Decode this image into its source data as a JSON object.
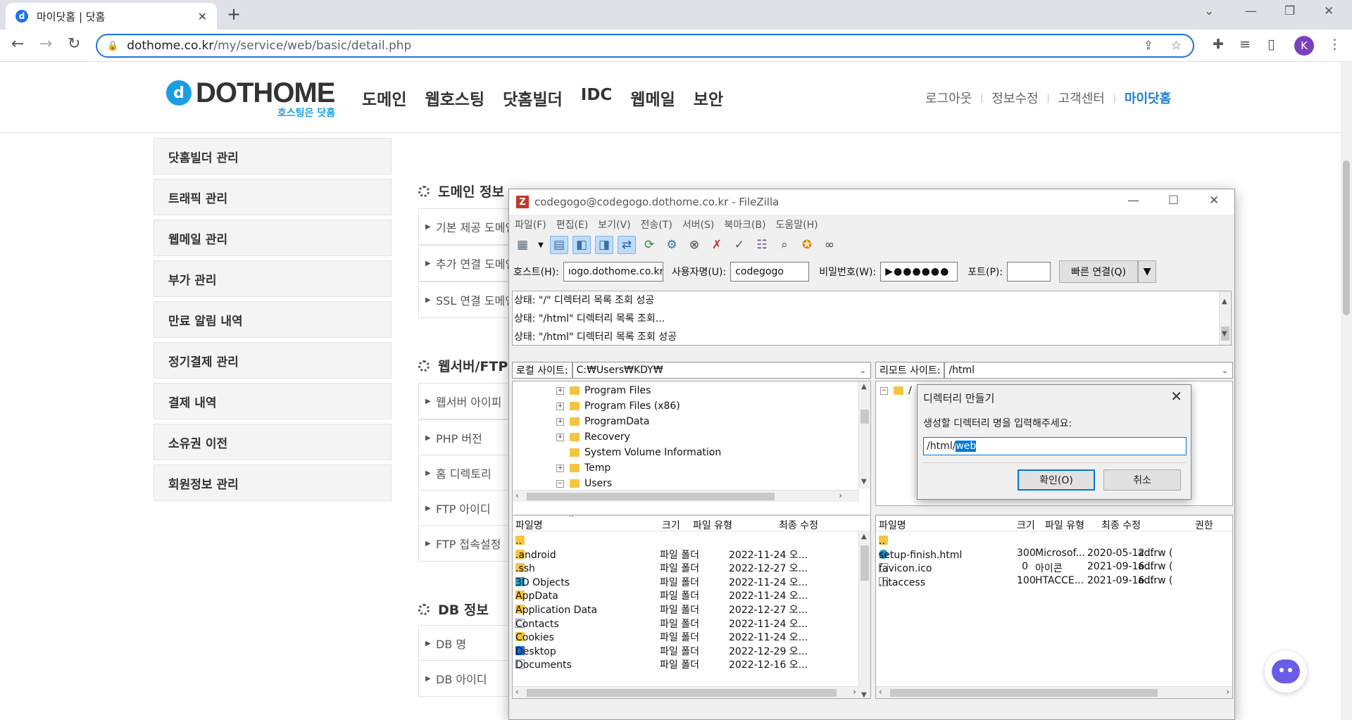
{
  "browser": {
    "tab_title": "마이닷홈 | 닷홈",
    "url_host": "dothome.co.kr",
    "url_path": "/my/service/web/basic/detail.php",
    "avatar_letter": "K"
  },
  "site": {
    "logo_text": "DOTHOME",
    "logo_tagline": "호스팅은 닷홈",
    "main_nav": [
      "도메인",
      "웹호스팅",
      "닷홈빌더",
      "IDC",
      "웹메일",
      "보안"
    ],
    "user_nav": [
      "로그아웃",
      "정보수정",
      "고객센터",
      "마이닷홈"
    ],
    "side_menu": [
      "닷홈빌더 관리",
      "트래픽 관리",
      "웹메일 관리",
      "부가 관리",
      "만료 알림 내역",
      "정기결제 관리",
      "결제 내역",
      "소유권 이전",
      "회원정보 관리"
    ],
    "sections": {
      "domain": {
        "title": "도메인 정보",
        "rows": [
          "기본 제공 도메인",
          "추가 연결 도메인",
          "SSL 연결 도메인"
        ]
      },
      "webserver": {
        "title": "웹서버/FTP",
        "rows": [
          "웹서버 아이피",
          "PHP 버전",
          "홈 디렉토리",
          "FTP 아이디",
          "FTP 접속설정"
        ]
      },
      "db": {
        "title": "DB 정보",
        "rows": [
          "DB 명",
          "DB 아이디"
        ]
      }
    }
  },
  "filezilla": {
    "title": "codegogo@codegogo.dothome.co.kr - FileZilla",
    "menu": [
      "파일(F)",
      "편집(E)",
      "보기(V)",
      "전송(T)",
      "서버(S)",
      "북마크(B)",
      "도움말(H)"
    ],
    "quickconnect": {
      "host_label": "호스트(H):",
      "host_value": "ıogo.dothome.co.kr",
      "user_label": "사용자명(U):",
      "user_value": "codegogo",
      "pass_label": "비밀번호(W):",
      "pass_value": "▶●●●●●●",
      "port_label": "포트(P):",
      "port_value": "",
      "connect_label": "빠른 연결(Q)"
    },
    "log": [
      "상태:  \"/\" 디렉터리 목록 조회 성공",
      "상태:  \"/html\" 디렉터리 목록 조회...",
      "상태:  \"/html\" 디렉터리 목록 조회 성공"
    ],
    "local_label": "로컬 사이트:",
    "local_path": "C:₩Users₩KDY₩",
    "remote_label": "리모트 사이트:",
    "remote_path": "/html",
    "local_tree": [
      "Program Files",
      "Program Files (x86)",
      "ProgramData",
      "Recovery",
      "System Volume Information",
      "Temp",
      "Users"
    ],
    "local_headers": [
      "파일명",
      "크기",
      "파일 유형",
      "최종 수정"
    ],
    "local_files": [
      {
        "name": "..",
        "size": "",
        "type": "",
        "modified": ""
      },
      {
        "name": ".android",
        "size": "",
        "type": "파일 폴더",
        "modified": "2022-11-24 오..."
      },
      {
        "name": ".ssh",
        "size": "",
        "type": "파일 폴더",
        "modified": "2022-12-27 오..."
      },
      {
        "name": "3D Objects",
        "size": "",
        "type": "파일 폴더",
        "modified": "2022-11-24 오..."
      },
      {
        "name": "AppData",
        "size": "",
        "type": "파일 폴더",
        "modified": "2022-11-24 오..."
      },
      {
        "name": "Application Data",
        "size": "",
        "type": "파일 폴더",
        "modified": "2022-12-27 오..."
      },
      {
        "name": "Contacts",
        "size": "",
        "type": "파일 폴더",
        "modified": "2022-11-24 오..."
      },
      {
        "name": "Cookies",
        "size": "",
        "type": "파일 폴더",
        "modified": "2022-11-24 오..."
      },
      {
        "name": "Desktop",
        "size": "",
        "type": "파일 폴더",
        "modified": "2022-12-29 오..."
      },
      {
        "name": "Documents",
        "size": "",
        "type": "파일 폴더",
        "modified": "2022-12-16 오..."
      }
    ],
    "remote_headers": [
      "파일명",
      "크기",
      "파일 유형",
      "최종 수정",
      "권한"
    ],
    "remote_files": [
      {
        "name": "..",
        "size": "",
        "type": "",
        "modified": "",
        "perm": ""
      },
      {
        "name": "setup-finish.html",
        "size": "300",
        "type": "Microsof...",
        "modified": "2020-05-12...",
        "perm": "adfrw ("
      },
      {
        "name": "favicon.ico",
        "size": "0",
        "type": "아이콘",
        "modified": "2021-09-16...",
        "perm": "adfrw ("
      },
      {
        "name": ".htaccess",
        "size": "100",
        "type": "HTACCE...",
        "modified": "2021-09-16...",
        "perm": "adfrw ("
      }
    ]
  },
  "dialog": {
    "title": "디렉터리 만들기",
    "prompt": "생성할 디렉터리 명을 입력해주세요:",
    "value_prefix": "/html/",
    "value_selected": "web",
    "ok": "확인(O)",
    "cancel": "취소"
  }
}
